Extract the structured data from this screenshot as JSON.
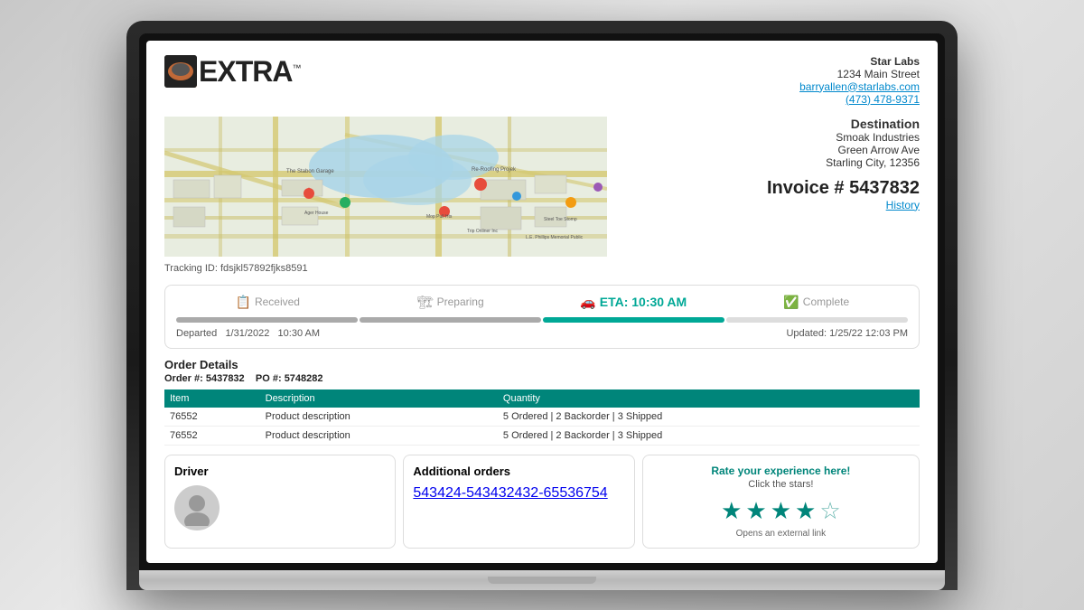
{
  "app": {
    "name": "EXTRA",
    "tm": "™"
  },
  "company": {
    "name": "Star Labs",
    "address": "1234 Main Street",
    "email": "barryallen@starlabs.com",
    "phone": "(473) 478-9371"
  },
  "destination": {
    "label": "Destination",
    "name": "Smoak Industries",
    "street": "Green Arrow Ave",
    "city": "Starling City, 12356"
  },
  "invoice": {
    "label": "Invoice #",
    "number": "5437832",
    "history_label": "History"
  },
  "tracking": {
    "id_label": "Tracking ID: fdsjkl57892fjks8591"
  },
  "status": {
    "steps": [
      {
        "icon": "📋",
        "label": "Received"
      },
      {
        "icon": "🏗",
        "label": "Preparing"
      },
      {
        "icon": "🚗",
        "label": "ETA: 10:30 AM",
        "active": true
      },
      {
        "icon": "✅",
        "label": "Complete"
      }
    ],
    "departed_label": "Departed",
    "departed_date": "1/31/2022",
    "departed_time": "10:30 AM",
    "updated_label": "Updated: 1/25/22 12:03 PM"
  },
  "order": {
    "title": "Order Details",
    "order_number": "Order #: 5437832",
    "po_number": "PO #: 5748282",
    "columns": [
      "Item",
      "Description",
      "Quantity"
    ],
    "rows": [
      {
        "item": "76552",
        "description": "Product description",
        "quantity": "5 Ordered  |  2 Backorder  |  3 Shipped"
      },
      {
        "item": "76552",
        "description": "Product description",
        "quantity": "5 Ordered  |  2 Backorder  |  3 Shipped"
      }
    ]
  },
  "driver": {
    "title": "Driver"
  },
  "additional_orders": {
    "title": "Additional orders",
    "links": [
      "543424-543",
      "432432-65",
      "536754"
    ]
  },
  "rating": {
    "title": "Rate your experience here!",
    "subtitle": "Click the stars!",
    "note": "Opens an external link",
    "stars": 4,
    "half": true
  }
}
